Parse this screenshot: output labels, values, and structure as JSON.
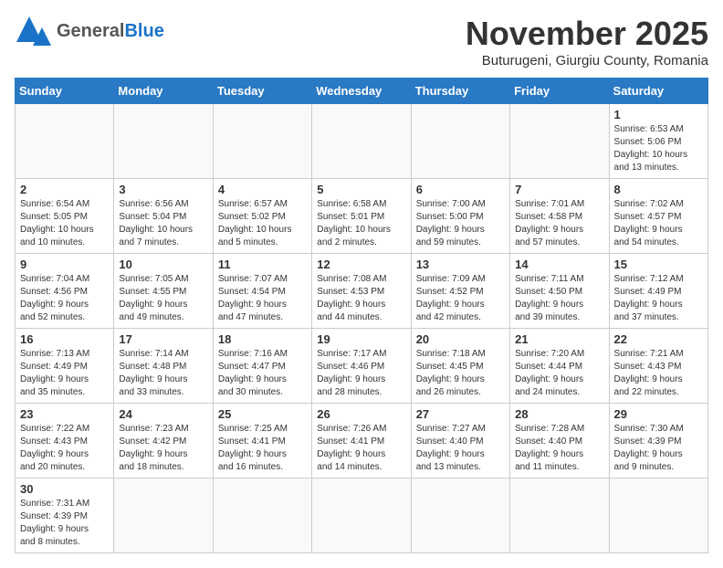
{
  "logo": {
    "line1": "General",
    "line2": "Blue"
  },
  "title": "November 2025",
  "subtitle": "Buturugeni, Giurgiu County, Romania",
  "weekdays": [
    "Sunday",
    "Monday",
    "Tuesday",
    "Wednesday",
    "Thursday",
    "Friday",
    "Saturday"
  ],
  "weeks": [
    [
      {
        "day": "",
        "info": ""
      },
      {
        "day": "",
        "info": ""
      },
      {
        "day": "",
        "info": ""
      },
      {
        "day": "",
        "info": ""
      },
      {
        "day": "",
        "info": ""
      },
      {
        "day": "",
        "info": ""
      },
      {
        "day": "1",
        "info": "Sunrise: 6:53 AM\nSunset: 5:06 PM\nDaylight: 10 hours\nand 13 minutes."
      }
    ],
    [
      {
        "day": "2",
        "info": "Sunrise: 6:54 AM\nSunset: 5:05 PM\nDaylight: 10 hours\nand 10 minutes."
      },
      {
        "day": "3",
        "info": "Sunrise: 6:56 AM\nSunset: 5:04 PM\nDaylight: 10 hours\nand 7 minutes."
      },
      {
        "day": "4",
        "info": "Sunrise: 6:57 AM\nSunset: 5:02 PM\nDaylight: 10 hours\nand 5 minutes."
      },
      {
        "day": "5",
        "info": "Sunrise: 6:58 AM\nSunset: 5:01 PM\nDaylight: 10 hours\nand 2 minutes."
      },
      {
        "day": "6",
        "info": "Sunrise: 7:00 AM\nSunset: 5:00 PM\nDaylight: 9 hours\nand 59 minutes."
      },
      {
        "day": "7",
        "info": "Sunrise: 7:01 AM\nSunset: 4:58 PM\nDaylight: 9 hours\nand 57 minutes."
      },
      {
        "day": "8",
        "info": "Sunrise: 7:02 AM\nSunset: 4:57 PM\nDaylight: 9 hours\nand 54 minutes."
      }
    ],
    [
      {
        "day": "9",
        "info": "Sunrise: 7:04 AM\nSunset: 4:56 PM\nDaylight: 9 hours\nand 52 minutes."
      },
      {
        "day": "10",
        "info": "Sunrise: 7:05 AM\nSunset: 4:55 PM\nDaylight: 9 hours\nand 49 minutes."
      },
      {
        "day": "11",
        "info": "Sunrise: 7:07 AM\nSunset: 4:54 PM\nDaylight: 9 hours\nand 47 minutes."
      },
      {
        "day": "12",
        "info": "Sunrise: 7:08 AM\nSunset: 4:53 PM\nDaylight: 9 hours\nand 44 minutes."
      },
      {
        "day": "13",
        "info": "Sunrise: 7:09 AM\nSunset: 4:52 PM\nDaylight: 9 hours\nand 42 minutes."
      },
      {
        "day": "14",
        "info": "Sunrise: 7:11 AM\nSunset: 4:50 PM\nDaylight: 9 hours\nand 39 minutes."
      },
      {
        "day": "15",
        "info": "Sunrise: 7:12 AM\nSunset: 4:49 PM\nDaylight: 9 hours\nand 37 minutes."
      }
    ],
    [
      {
        "day": "16",
        "info": "Sunrise: 7:13 AM\nSunset: 4:49 PM\nDaylight: 9 hours\nand 35 minutes."
      },
      {
        "day": "17",
        "info": "Sunrise: 7:14 AM\nSunset: 4:48 PM\nDaylight: 9 hours\nand 33 minutes."
      },
      {
        "day": "18",
        "info": "Sunrise: 7:16 AM\nSunset: 4:47 PM\nDaylight: 9 hours\nand 30 minutes."
      },
      {
        "day": "19",
        "info": "Sunrise: 7:17 AM\nSunset: 4:46 PM\nDaylight: 9 hours\nand 28 minutes."
      },
      {
        "day": "20",
        "info": "Sunrise: 7:18 AM\nSunset: 4:45 PM\nDaylight: 9 hours\nand 26 minutes."
      },
      {
        "day": "21",
        "info": "Sunrise: 7:20 AM\nSunset: 4:44 PM\nDaylight: 9 hours\nand 24 minutes."
      },
      {
        "day": "22",
        "info": "Sunrise: 7:21 AM\nSunset: 4:43 PM\nDaylight: 9 hours\nand 22 minutes."
      }
    ],
    [
      {
        "day": "23",
        "info": "Sunrise: 7:22 AM\nSunset: 4:43 PM\nDaylight: 9 hours\nand 20 minutes."
      },
      {
        "day": "24",
        "info": "Sunrise: 7:23 AM\nSunset: 4:42 PM\nDaylight: 9 hours\nand 18 minutes."
      },
      {
        "day": "25",
        "info": "Sunrise: 7:25 AM\nSunset: 4:41 PM\nDaylight: 9 hours\nand 16 minutes."
      },
      {
        "day": "26",
        "info": "Sunrise: 7:26 AM\nSunset: 4:41 PM\nDaylight: 9 hours\nand 14 minutes."
      },
      {
        "day": "27",
        "info": "Sunrise: 7:27 AM\nSunset: 4:40 PM\nDaylight: 9 hours\nand 13 minutes."
      },
      {
        "day": "28",
        "info": "Sunrise: 7:28 AM\nSunset: 4:40 PM\nDaylight: 9 hours\nand 11 minutes."
      },
      {
        "day": "29",
        "info": "Sunrise: 7:30 AM\nSunset: 4:39 PM\nDaylight: 9 hours\nand 9 minutes."
      }
    ],
    [
      {
        "day": "30",
        "info": "Sunrise: 7:31 AM\nSunset: 4:39 PM\nDaylight: 9 hours\nand 8 minutes."
      },
      {
        "day": "",
        "info": ""
      },
      {
        "day": "",
        "info": ""
      },
      {
        "day": "",
        "info": ""
      },
      {
        "day": "",
        "info": ""
      },
      {
        "day": "",
        "info": ""
      },
      {
        "day": "",
        "info": ""
      }
    ]
  ]
}
